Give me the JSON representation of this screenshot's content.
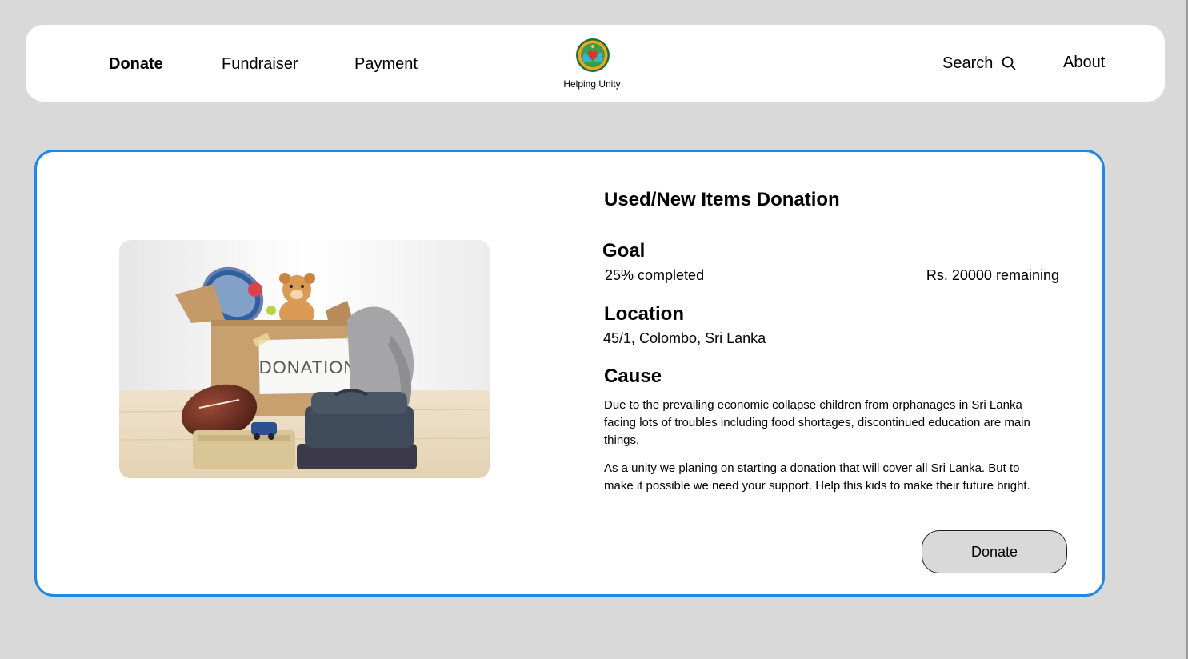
{
  "header": {
    "nav": {
      "donate": "Donate",
      "fundraiser": "Fundraiser",
      "payment": "Payment",
      "search": "Search",
      "about": "About"
    },
    "brand": "Helping Unity",
    "icons": {
      "logo": "heart-hands-logo-icon",
      "search": "search-icon"
    }
  },
  "campaign": {
    "title": "Used/New Items Donation",
    "goal": {
      "heading": "Goal",
      "progress_text": "25% completed",
      "remaining_text": "Rs. 20000 remaining"
    },
    "location": {
      "heading": "Location",
      "value": "45/1, Colombo, Sri Lanka"
    },
    "cause": {
      "heading": "Cause",
      "paragraph1": "Due to the prevailing economic collapse children from orphanages in Sri Lanka facing lots of troubles including food shortages, discontinued education are main things.",
      "paragraph2": "As a unity we planing on starting a donation that will cover all Sri Lanka. But to make it possible we need your support. Help this kids to make their future bright."
    },
    "image": {
      "box_label": "DONATION"
    },
    "donate_button": "Donate"
  },
  "colors": {
    "page_background": "#d9d9d9",
    "card_border": "#1e88e5",
    "button_background": "#d9d9d9"
  }
}
